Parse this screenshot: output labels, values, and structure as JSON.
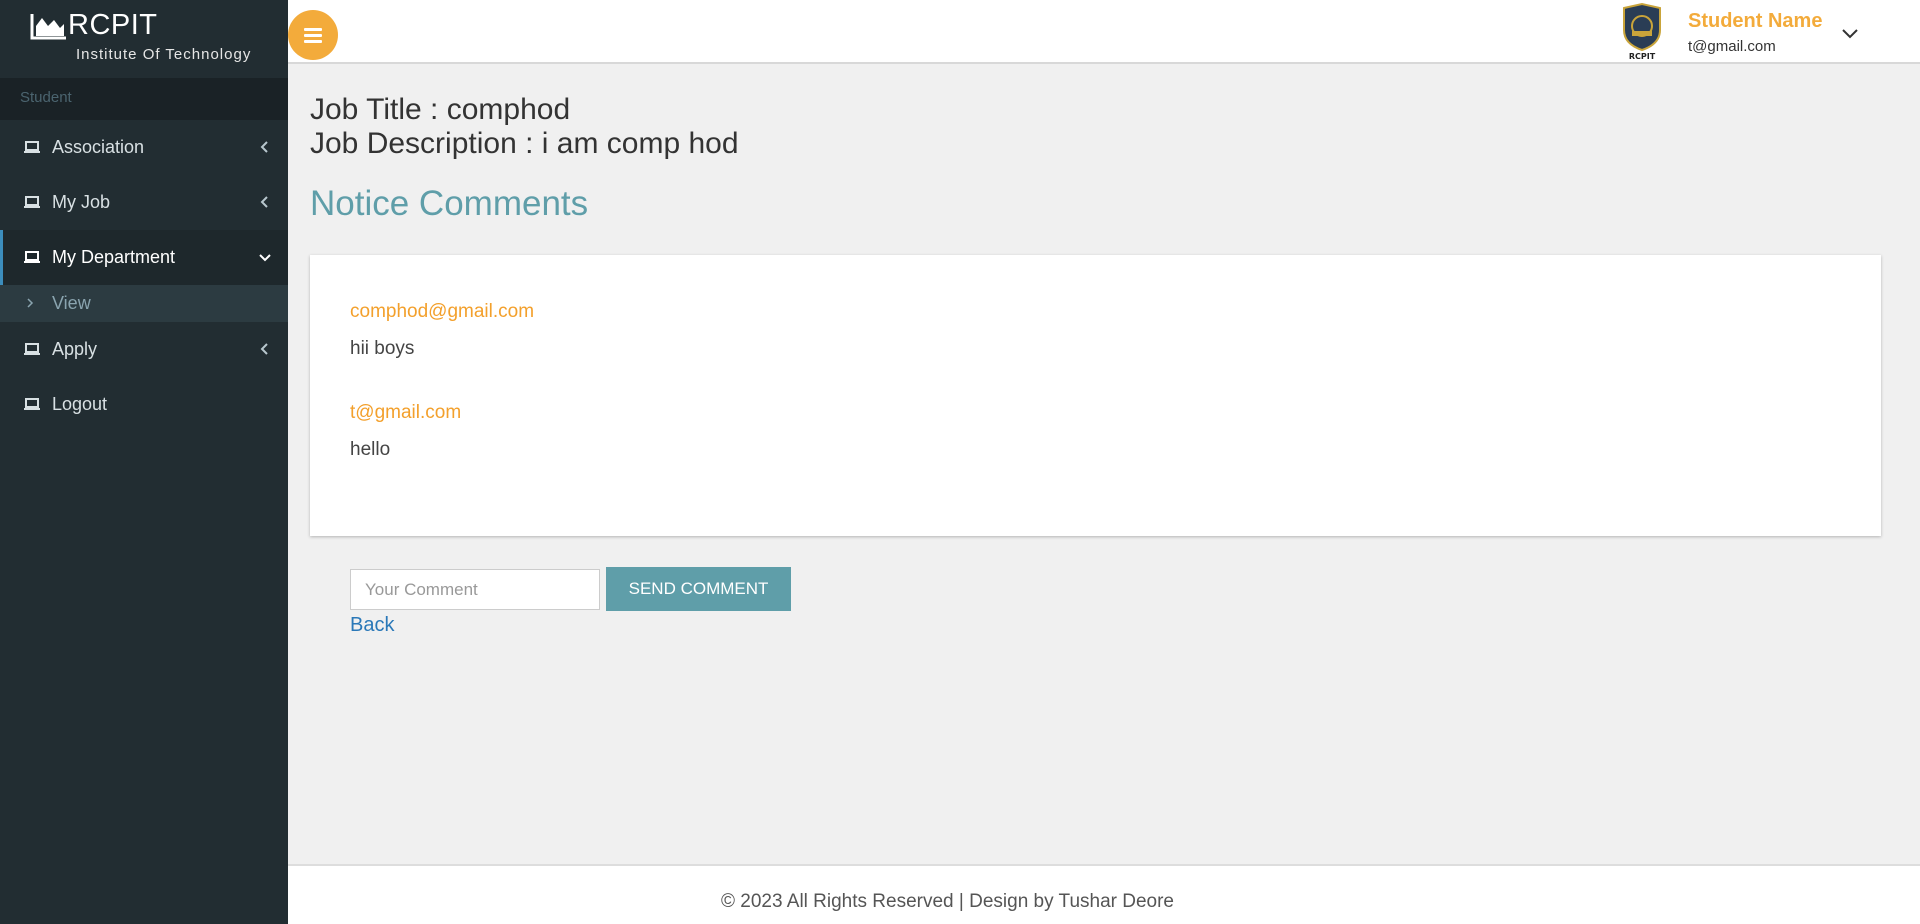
{
  "brand": {
    "name": "RCPIT",
    "subtitle": "Institute Of Technology",
    "logo_icon": "chart-icon"
  },
  "sidebar": {
    "section_label": "Student",
    "items": [
      {
        "label": "Association",
        "icon": "laptop-icon",
        "expanded": false
      },
      {
        "label": "My Job",
        "icon": "laptop-icon",
        "expanded": false
      },
      {
        "label": "My Department",
        "icon": "laptop-icon",
        "expanded": true,
        "subitems": [
          {
            "label": "View"
          }
        ]
      },
      {
        "label": "Apply",
        "icon": "laptop-icon",
        "expanded": false
      },
      {
        "label": "Logout",
        "icon": "laptop-icon"
      }
    ]
  },
  "header": {
    "menu_icon": "hamburger-icon",
    "user": {
      "name": "Student Name",
      "email": "t@gmail.com",
      "logo_text": "RCPIT"
    }
  },
  "job": {
    "title": "Job Title : comphod",
    "description": "Job Description : i am comp hod"
  },
  "notice_heading": "Notice Comments",
  "comments": [
    {
      "author": "comphod@gmail.com",
      "text": "hii boys"
    },
    {
      "author": "t@gmail.com",
      "text": "hello"
    }
  ],
  "comment_form": {
    "placeholder": "Your Comment",
    "value": "",
    "send_label": "SEND COMMENT",
    "back_label": "Back"
  },
  "footer": {
    "text": "© 2023 All Rights Reserved | Design by Tushar Deore"
  },
  "colors": {
    "sidebar_bg": "#222d32",
    "accent_orange": "#f3ab3b",
    "teal": "#5f9ea9",
    "link_blue": "#2a78b8"
  }
}
